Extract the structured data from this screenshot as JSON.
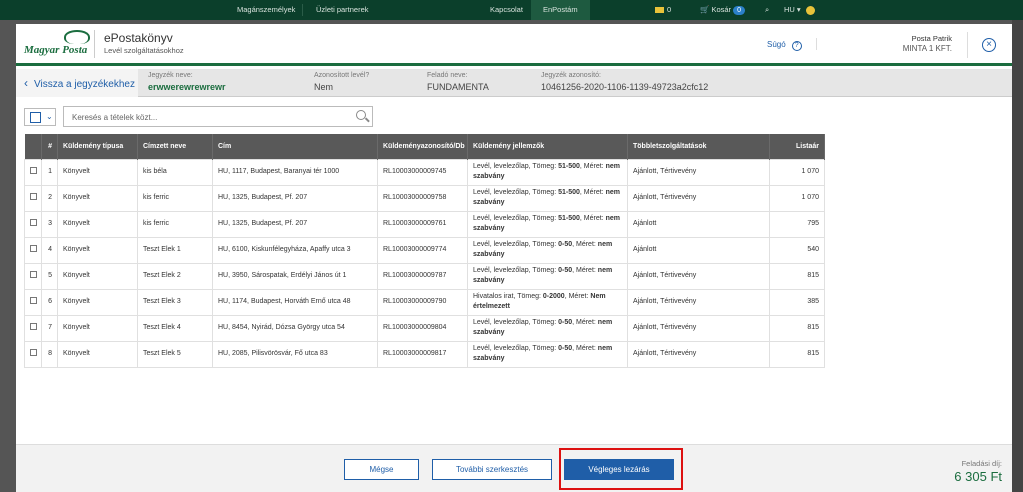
{
  "topnav": {
    "items": [
      "Magánszemélyek",
      "Üzleti partnerek",
      "Kapcsolat",
      "EnPostám"
    ],
    "mail_count": "0",
    "cart_label": "Kosár",
    "cart_count": "0",
    "lang": "HU"
  },
  "header": {
    "logo_text": "Magyar Posta",
    "title": "ePostakönyv",
    "subtitle": "Levél szolgáltatásokhoz",
    "help_label": "Súgó",
    "user_name": "Posta Patrik",
    "user_org": "MINTA 1 KFT."
  },
  "infobar": {
    "back_label": "Vissza a jegyzékekhez",
    "fields": [
      {
        "label": "Jegyzék neve:",
        "value": "erwwerewrewrewr"
      },
      {
        "label": "Azonosított levél?",
        "value": "Nem"
      },
      {
        "label": "Feladó neve:",
        "value": "FUNDAMENTA"
      },
      {
        "label": "Jegyzék azonosító:",
        "value": "10461256-2020-1106-1139-49723a2cfc12"
      }
    ]
  },
  "search": {
    "placeholder": "Keresés a tételek közt..."
  },
  "table": {
    "columns": [
      "#",
      "Küldemény típusa",
      "Címzett neve",
      "Cím",
      "Küldeményazonosító/Db",
      "Küldemény jellemzők",
      "Többletszolgáltatások",
      "Listaár"
    ],
    "rows": [
      {
        "n": "1",
        "type": "Könyvelt",
        "name": "kis béla",
        "addr": "HU, 1117, Budapest, Baranyai tér 1000",
        "id": "RL10003000009745",
        "pre": "Levél, levelezőlap, Tömeg: ",
        "weight": "51-500",
        "mid": ", Méret: ",
        "size": "nem szabvány",
        "extra": "Ajánlott, Tértivevény",
        "price": "1 070"
      },
      {
        "n": "2",
        "type": "Könyvelt",
        "name": "kis ferric",
        "addr": "HU, 1325, Budapest, Pf. 207",
        "id": "RL10003000009758",
        "pre": "Levél, levelezőlap, Tömeg: ",
        "weight": "51-500",
        "mid": ", Méret: ",
        "size": "nem szabvány",
        "extra": "Ajánlott, Tértivevény",
        "price": "1 070"
      },
      {
        "n": "3",
        "type": "Könyvelt",
        "name": "kis ferric",
        "addr": "HU, 1325, Budapest, Pf. 207",
        "id": "RL10003000009761",
        "pre": "Levél, levelezőlap, Tömeg: ",
        "weight": "51-500",
        "mid": ", Méret: ",
        "size": "nem szabvány",
        "extra": "Ajánlott",
        "price": "795"
      },
      {
        "n": "4",
        "type": "Könyvelt",
        "name": "Teszt Elek 1",
        "addr": "HU, 6100, Kiskunfélegyháza, Apaffy utca 3",
        "id": "RL10003000009774",
        "pre": "Levél, levelezőlap, Tömeg: ",
        "weight": "0-50",
        "mid": ", Méret: ",
        "size": "nem szabvány",
        "extra": "Ajánlott",
        "price": "540"
      },
      {
        "n": "5",
        "type": "Könyvelt",
        "name": "Teszt Elek 2",
        "addr": "HU, 3950, Sárospatak, Erdélyi János út 1",
        "id": "RL10003000009787",
        "pre": "Levél, levelezőlap, Tömeg: ",
        "weight": "0-50",
        "mid": ", Méret: ",
        "size": "nem szabvány",
        "extra": "Ajánlott, Tértivevény",
        "price": "815"
      },
      {
        "n": "6",
        "type": "Könyvelt",
        "name": "Teszt Elek 3",
        "addr": "HU, 1174, Budapest, Horváth Ernő utca 48",
        "id": "RL10003000009790",
        "pre": "Hivatalos irat, Tömeg: ",
        "weight": "0-2000",
        "mid": ", Méret: ",
        "size": "Nem értelmezett",
        "extra": "Ajánlott, Tértivevény",
        "price": "385"
      },
      {
        "n": "7",
        "type": "Könyvelt",
        "name": "Teszt Elek 4",
        "addr": "HU, 8454, Nyirád, Dózsa György utca 54",
        "id": "RL10003000009804",
        "pre": "Levél, levelezőlap, Tömeg: ",
        "weight": "0-50",
        "mid": ", Méret: ",
        "size": "nem szabvány",
        "extra": "Ajánlott, Tértivevény",
        "price": "815"
      },
      {
        "n": "8",
        "type": "Könyvelt",
        "name": "Teszt Elek 5",
        "addr": "HU, 2085, Pilisvörösvár, Fő utca 83",
        "id": "RL10003000009817",
        "pre": "Levél, levelezőlap, Tömeg: ",
        "weight": "0-50",
        "mid": ", Méret: ",
        "size": "nem szabvány",
        "extra": "Ajánlott, Tértivevény",
        "price": "815"
      }
    ]
  },
  "footer": {
    "cancel_label": "Mégse",
    "edit_label": "További szerkesztés",
    "finalize_label": "Végleges lezárás",
    "fee_label": "Feladási díj:",
    "fee_value": "6 305 Ft"
  },
  "colors": {
    "brand_green": "#1b6d3f",
    "accent_blue": "#1f5ea8",
    "highlight_red": "#dd1111"
  }
}
